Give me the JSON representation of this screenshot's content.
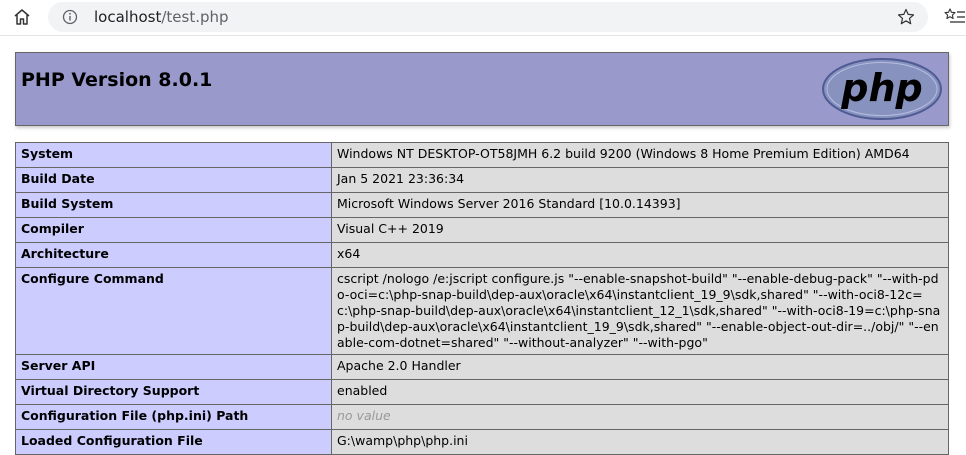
{
  "browser": {
    "url_host": "localhost",
    "url_path": "/test.php"
  },
  "page": {
    "title": "PHP Version 8.0.1",
    "logo_text": "php"
  },
  "rows": [
    {
      "label": "System",
      "value": "Windows NT DESKTOP-OT58JMH 6.2 build 9200 (Windows 8 Home Premium Edition) AMD64"
    },
    {
      "label": "Build Date",
      "value": "Jan 5 2021 23:36:34"
    },
    {
      "label": "Build System",
      "value": "Microsoft Windows Server 2016 Standard [10.0.14393]"
    },
    {
      "label": "Compiler",
      "value": "Visual C++ 2019"
    },
    {
      "label": "Architecture",
      "value": "x64"
    },
    {
      "label": "Configure Command",
      "value": "cscript /nologo /e:jscript configure.js \"--enable-snapshot-build\" \"--enable-debug-pack\" \"--with-pdo-oci=c:\\php-snap-build\\dep-aux\\oracle\\x64\\instantclient_19_9\\sdk,shared\" \"--with-oci8-12c=c:\\php-snap-build\\dep-aux\\oracle\\x64\\instantclient_12_1\\sdk,shared\" \"--with-oci8-19=c:\\php-snap-build\\dep-aux\\oracle\\x64\\instantclient_19_9\\sdk,shared\" \"--enable-object-out-dir=../obj/\" \"--enable-com-dotnet=shared\" \"--without-analyzer\" \"--with-pgo\""
    },
    {
      "label": "Server API",
      "value": "Apache 2.0 Handler"
    },
    {
      "label": "Virtual Directory Support",
      "value": "enabled"
    },
    {
      "label": "Configuration File (php.ini) Path",
      "value": "no value"
    },
    {
      "label": "Loaded Configuration File",
      "value": "G:\\wamp\\php\\php.ini"
    }
  ],
  "colors": {
    "header_bg": "#9999cc",
    "label_bg": "#ccccff",
    "value_bg": "#dddddd",
    "logo_bg": "#8892bf"
  },
  "icons": {
    "home": "home-icon",
    "info": "info-icon",
    "star": "star-icon",
    "favorites": "favorites-list-icon"
  }
}
